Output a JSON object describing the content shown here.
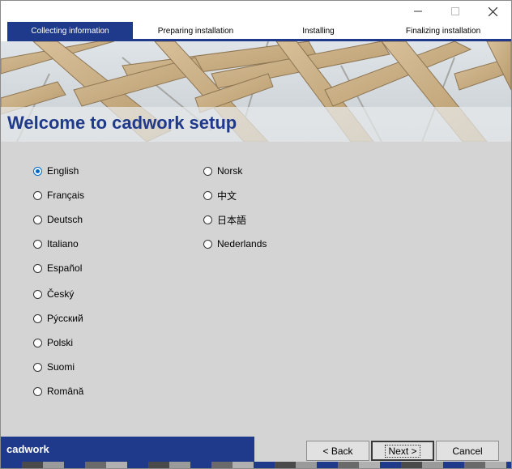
{
  "window": {
    "controls": [
      {
        "name": "minimize-icon"
      },
      {
        "name": "maximize-icon"
      },
      {
        "name": "close-icon"
      }
    ]
  },
  "steps": [
    {
      "label": "Collecting information",
      "active": true
    },
    {
      "label": "Preparing installation",
      "active": false
    },
    {
      "label": "Installing",
      "active": false
    },
    {
      "label": "Finalizing installation",
      "active": false
    }
  ],
  "banner": {
    "title": "Welcome to cadwork setup"
  },
  "languages": {
    "selected": "English",
    "column1": [
      "English",
      "Français",
      "Deutsch",
      "Italiano",
      "Español",
      "Český",
      "Рýсский",
      "Polski",
      "Suomi",
      "Română"
    ],
    "column2": [
      "Norsk",
      "中文",
      "日本語",
      "Nederlands"
    ]
  },
  "footer": {
    "brand": "cadwork",
    "back_label": "< Back",
    "next_label": "Next >",
    "cancel_label": "Cancel"
  },
  "colors": {
    "accent": "#1f3a8a",
    "background": "#d4d4d4",
    "radio_selected": "#0066cc"
  }
}
